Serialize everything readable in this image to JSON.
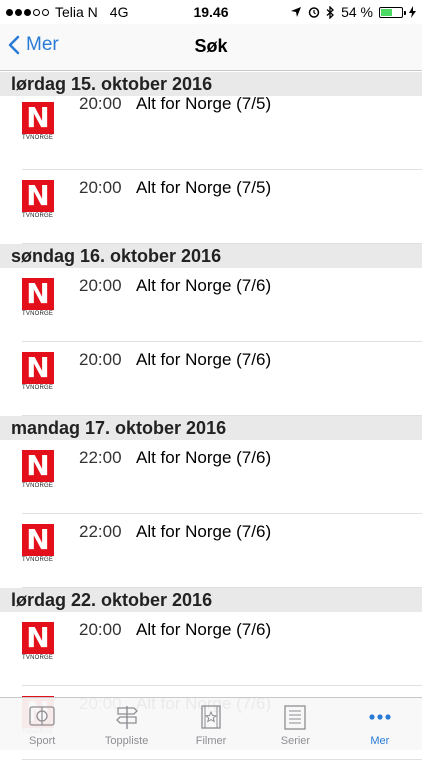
{
  "status": {
    "carrier": "Telia N",
    "network": "4G",
    "time": "19.46",
    "battery": "54 %",
    "battery_level": 0.54
  },
  "nav": {
    "back_label": "Mer",
    "title": "Søk"
  },
  "sections": [
    {
      "header": "lørdag 15. oktober 2016",
      "rows": [
        {
          "time": "20:00",
          "title": "Alt for Norge (7/5)",
          "channel": "TVNORGE"
        },
        {
          "time": "20:00",
          "title": "Alt for Norge (7/5)",
          "channel": "TVNORGE"
        }
      ]
    },
    {
      "header": "søndag 16. oktober 2016",
      "rows": [
        {
          "time": "20:00",
          "title": "Alt for Norge (7/6)",
          "channel": "TVNORGE"
        },
        {
          "time": "20:00",
          "title": "Alt for Norge (7/6)",
          "channel": "TVNORGE"
        }
      ]
    },
    {
      "header": "mandag 17. oktober 2016",
      "rows": [
        {
          "time": "22:00",
          "title": "Alt for Norge (7/6)",
          "channel": "TVNORGE"
        },
        {
          "time": "22:00",
          "title": "Alt for Norge (7/6)",
          "channel": "TVNORGE"
        }
      ]
    },
    {
      "header": "lørdag 22. oktober 2016",
      "rows": [
        {
          "time": "20:00",
          "title": "Alt for Norge (7/6)",
          "channel": "TVNORGE"
        },
        {
          "time": "20:00",
          "title": "Alt for Norge (7/6)",
          "channel": "TVNORGE"
        }
      ]
    }
  ],
  "logo_letter": "N",
  "tabs": [
    {
      "label": "Sport",
      "icon": "sport-icon",
      "active": false
    },
    {
      "label": "Toppliste",
      "icon": "signpost-icon",
      "active": false
    },
    {
      "label": "Filmer",
      "icon": "film-icon",
      "active": false
    },
    {
      "label": "Serier",
      "icon": "series-icon",
      "active": false
    },
    {
      "label": "Mer",
      "icon": "more-dots-icon",
      "active": true
    }
  ],
  "colors": {
    "accent": "#2a7bd6",
    "channel_red": "#e3101b",
    "section_bg": "#e9e9ea"
  }
}
